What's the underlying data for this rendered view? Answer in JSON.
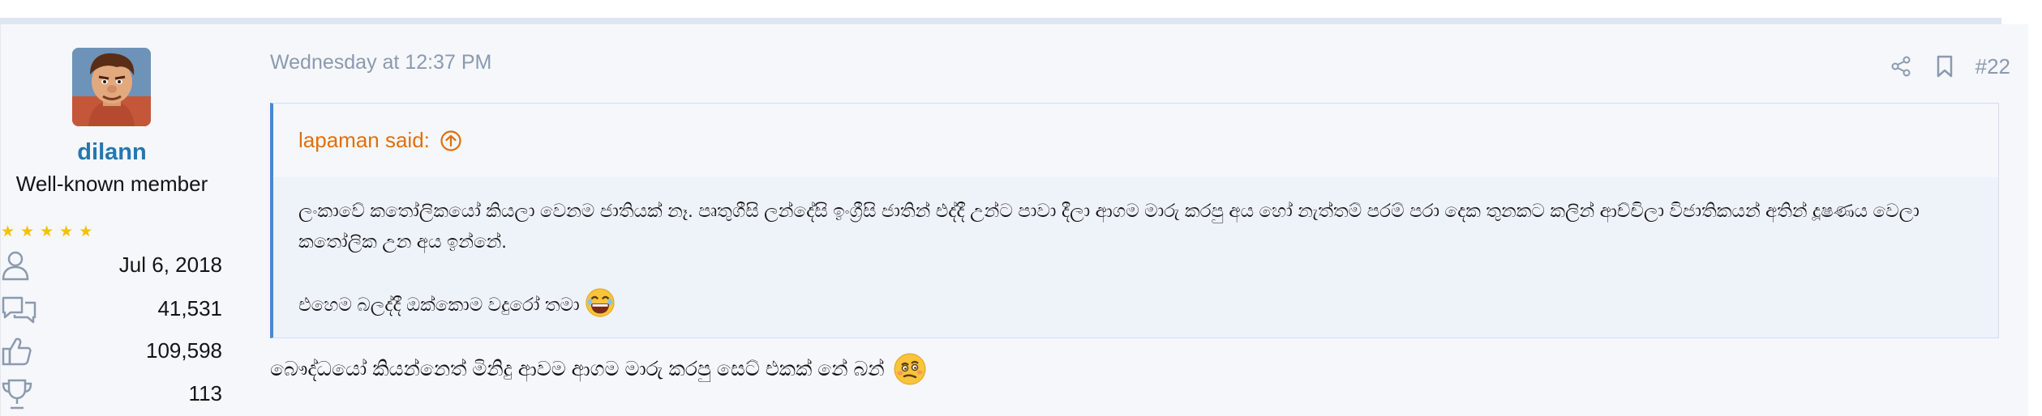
{
  "user": {
    "name": "dilann",
    "title": "Well-known member",
    "stars": 5,
    "stats": [
      {
        "icon": "user-icon",
        "value": "Jul 6, 2018"
      },
      {
        "icon": "messages-icon",
        "value": "41,531"
      },
      {
        "icon": "thumbs-up-icon",
        "value": "109,598"
      },
      {
        "icon": "trophy-icon",
        "value": "113"
      }
    ]
  },
  "post": {
    "date": "Wednesday at 12:37 PM",
    "number": "#22",
    "actions": [
      "share-icon",
      "bookmark-icon"
    ]
  },
  "quote": {
    "author_said": "lapaman said:",
    "paragraph1": "ලංකාවේ කතෝලිකයෝ කියලා වෙනම ජාතියක් නෑ. පෘතුගීසි ලන්දේසි ඉංග්‍රීසි ජාතින් එද්දී උන්ට පාවා දීලා ආගම මාරු කරපු අය හෝ නැත්තම් පරම් පරා දෙක තුනකට කලින් ආච්චිලා විජාතිකයන් අතින් දූෂණය වෙලා කතෝලික උන අය ඉන්නේ.",
    "paragraph2": "එහෙම බලද්දී ඔක්කොම වදුරෝ තමා",
    "emoji": "laughing-face"
  },
  "reply": {
    "text": "බෞද්ධයෝ කියන්නෙත් මිනිදු ආවම ආගම මාරු කරපු සෙට් එකක් නේ බන්",
    "emoji": "dizzy-face"
  },
  "colors": {
    "accent": "#2577b1",
    "quote_author": "#e0700d",
    "quote_border": "#4a89cc",
    "muted": "#8c9aae",
    "stars": "#f2c200"
  }
}
